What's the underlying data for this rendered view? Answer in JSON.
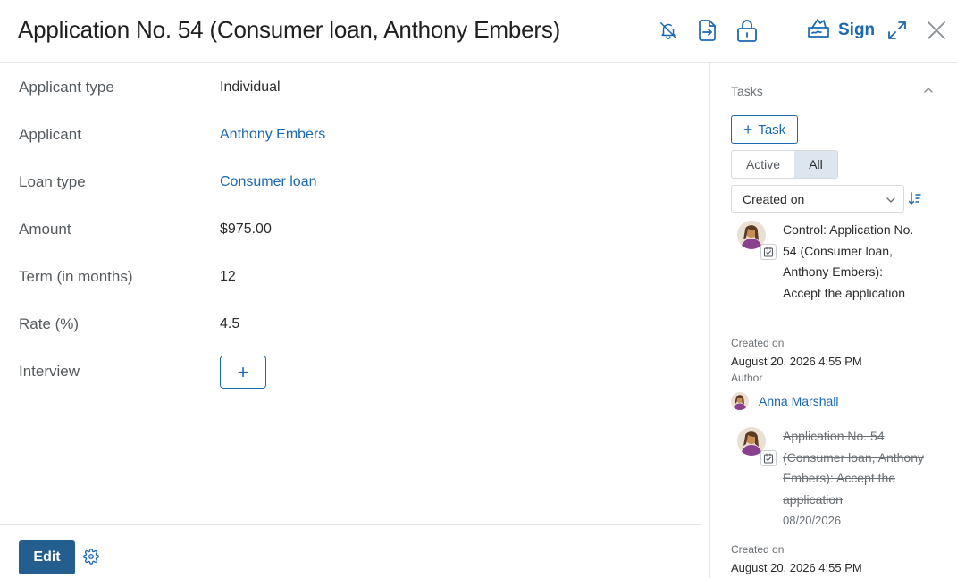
{
  "header": {
    "title": "Application No. 54 (Consumer loan, Anthony Embers)",
    "sign_label": "Sign",
    "icons": [
      "bell-off-icon",
      "export-icon",
      "lock-icon",
      "sign-icon",
      "expand-icon",
      "close-icon"
    ]
  },
  "form": {
    "rows": [
      {
        "label": "Applicant type",
        "value": "Individual"
      },
      {
        "label": "Applicant",
        "value": "Anthony Embers"
      },
      {
        "label": "Loan type",
        "value": "Consumer loan"
      },
      {
        "label": "Amount",
        "value": "$975.00"
      },
      {
        "label": "Term (in months)",
        "value": "12"
      },
      {
        "label": "Rate (%)",
        "value": "4.5"
      },
      {
        "label": "Interview",
        "value": "+"
      }
    ],
    "edit_label": "Edit"
  },
  "tasks": {
    "title": "Tasks",
    "add_label": "Task",
    "filters": [
      "Active",
      "All"
    ],
    "active_filter": "All",
    "sort_by": "Created on",
    "items": [
      {
        "text": "Control: Application No. 54 (Consumer loan, Anthony Embers): Accept the application",
        "lines": [
          "Control: Application No.",
          "54 (Consumer loan,",
          "Anthony Embers):",
          "Accept the application"
        ],
        "completed": false,
        "created_label": "Created on",
        "created_value": "August 20, 2026 4:55 PM",
        "author_label": "Author",
        "author_name": "Anna Marshall"
      },
      {
        "text": "Application No. 54 (Consumer loan, Anthony Embers): Accept the application",
        "lines": [
          "Application No. 54",
          "(Consumer loan, Anthony",
          "Embers): Accept the",
          "application"
        ],
        "completed": true,
        "date": "08/20/2026",
        "created_label": "Created on",
        "created_value": "August 20, 2026 4:55 PM"
      }
    ]
  },
  "colors": {
    "link": "#1a69b1",
    "primary_button": "#235e8f",
    "divider": "#e3e6e9"
  }
}
